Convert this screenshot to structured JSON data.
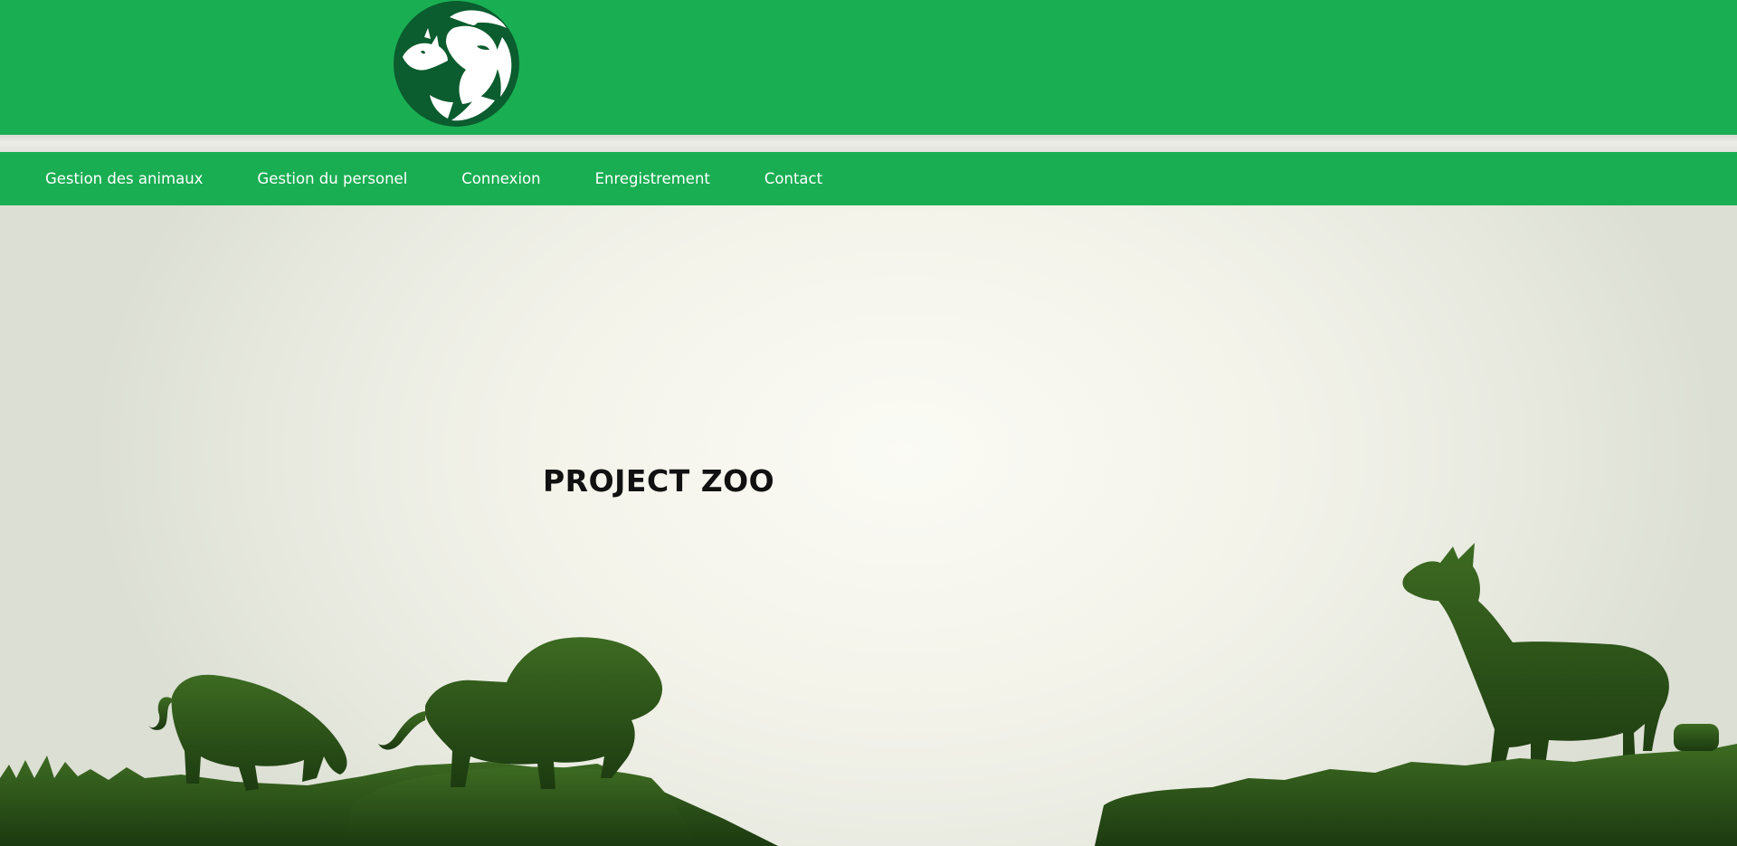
{
  "header": {
    "logo_icon": "lion-and-rhino-logo-icon",
    "background_color": "#1aae53",
    "logo_color": "#0b5c2e"
  },
  "nav": {
    "items": [
      {
        "label": "Gestion des animaux"
      },
      {
        "label": "Gestion du personel"
      },
      {
        "label": "Connexion"
      },
      {
        "label": "Enregistrement"
      },
      {
        "label": "Contact"
      }
    ]
  },
  "hero": {
    "title": "PROJECT ZOO",
    "illustration": "savanna-animals-silhouette",
    "silhouette_color": "#2d5a18"
  }
}
